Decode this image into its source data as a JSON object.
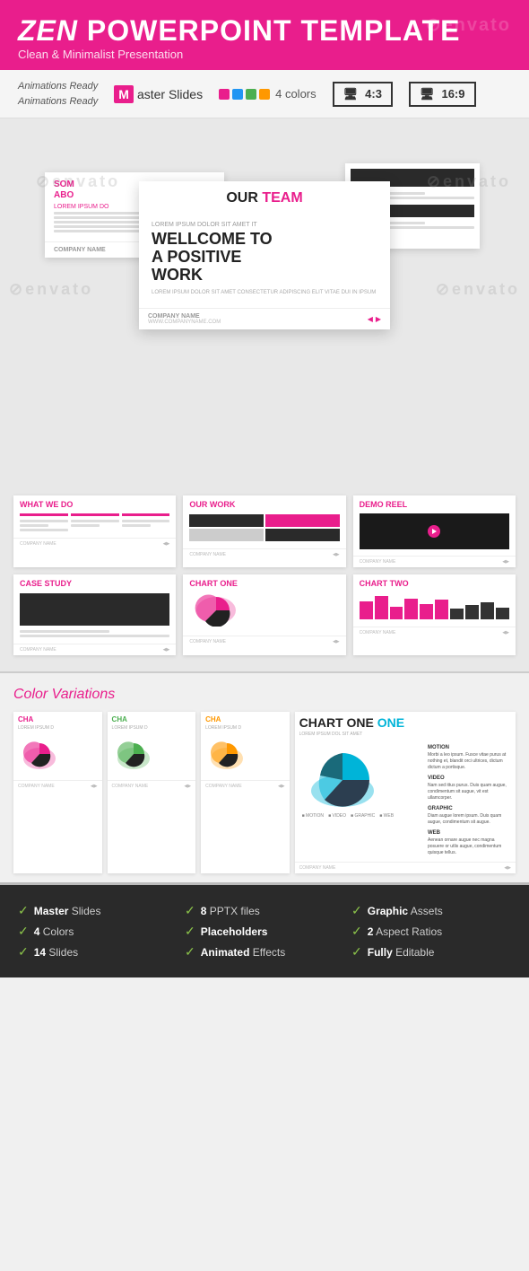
{
  "header": {
    "title_zen": "ZEN",
    "title_rest": " POWERPOINT TEMPLATE",
    "subtitle": "Clean & Minimalist Presentation",
    "watermark": "⊘envato"
  },
  "features_bar": {
    "animations_ready": [
      "Animations Ready",
      "Animations Ready"
    ],
    "master_slides_label": "aster Slides",
    "colors_label": "4 colors",
    "ratio_43": "4:3",
    "ratio_169": "16:9",
    "colors": [
      "#e91e8c",
      "#2196f3",
      "#4caf50",
      "#ff9800"
    ]
  },
  "slides": {
    "main": {
      "our_team_label": "OUR ",
      "our_team_highlight": "TEAM",
      "welcome_small": "LOREM IPSUM DOLOR SIT AMET IT",
      "welcome_title": "WELLCOME",
      "welcome_title2": " TO",
      "welcome_line2": "A POSITIVE",
      "welcome_line3": "WORK",
      "welcome_desc": "LOREM IPSUM DOLOR SIT AMET CONSECTETUR\nADIPISCING ELIT VITAE DUI IN IPSUM",
      "company_name": "COMPANY NAME",
      "website": "WWW.COMPANYNAME.COM"
    },
    "left": {
      "title1": "SOM",
      "title2": "ABO",
      "lorem": "LOREM IPSUM DO"
    },
    "grid_thumbs": [
      {
        "id": "what-we-do",
        "title": "WHAT ",
        "highlight": "WE DO",
        "company": "COMPANY NAME",
        "type": "table"
      },
      {
        "id": "our-work",
        "title": "OUR ",
        "highlight": "WORK",
        "company": "COMPANY NAME",
        "type": "grid"
      },
      {
        "id": "demo-reel",
        "title": "DEMO ",
        "highlight": "REEL",
        "company": "COMPANY NAME",
        "type": "video"
      },
      {
        "id": "case-study",
        "title": "CASE ",
        "highlight": "STUDY",
        "company": "COMPANY NAME",
        "type": "dark"
      },
      {
        "id": "chart-one",
        "title": "CHART ",
        "highlight": "ONE",
        "company": "COMPANY NAME",
        "type": "pie"
      },
      {
        "id": "chart-two",
        "title": "CHART ",
        "highlight": "TWO",
        "company": "COMPANY NAME",
        "type": "bar"
      }
    ]
  },
  "color_variations": {
    "title_italic": "Color",
    "title_rest": " Variations",
    "variants": [
      {
        "id": "v-pink",
        "color": "#e91e8c",
        "title": "CHA",
        "sub": "LOREM IPSUM D",
        "pie_color": "#e91e8c"
      },
      {
        "id": "v-green",
        "color": "#4caf50",
        "title": "CHA",
        "sub": "LOREM IPSUM D",
        "pie_color": "#4caf50"
      },
      {
        "id": "v-orange",
        "color": "#ff9800",
        "title": "CHA",
        "sub": "LOREM IPSUM D",
        "pie_color": "#ff9800"
      },
      {
        "id": "v-blue",
        "color": "#00b4d8",
        "title": "CHART ONE",
        "sub": "LOREM IPSUM DOL SIT AMET",
        "pie_color": "#00b4d8",
        "large": true
      }
    ]
  },
  "bottom_features": {
    "col1": [
      {
        "bold": "Master",
        "rest": " Slides"
      },
      {
        "bold": "4",
        "rest": " Colors"
      },
      {
        "bold": "14",
        "rest": " Slides"
      }
    ],
    "col2": [
      {
        "bold": "8",
        "rest": " PPTX files"
      },
      {
        "bold": "Placeholders"
      },
      {
        "bold": "Animated",
        "rest": " Effects"
      }
    ],
    "col3": [
      {
        "bold": "Graphic",
        "rest": " Assets"
      },
      {
        "bold": "2",
        "rest": " Aspect Ratios"
      },
      {
        "bold": "Fully",
        "rest": " Editable"
      }
    ]
  }
}
